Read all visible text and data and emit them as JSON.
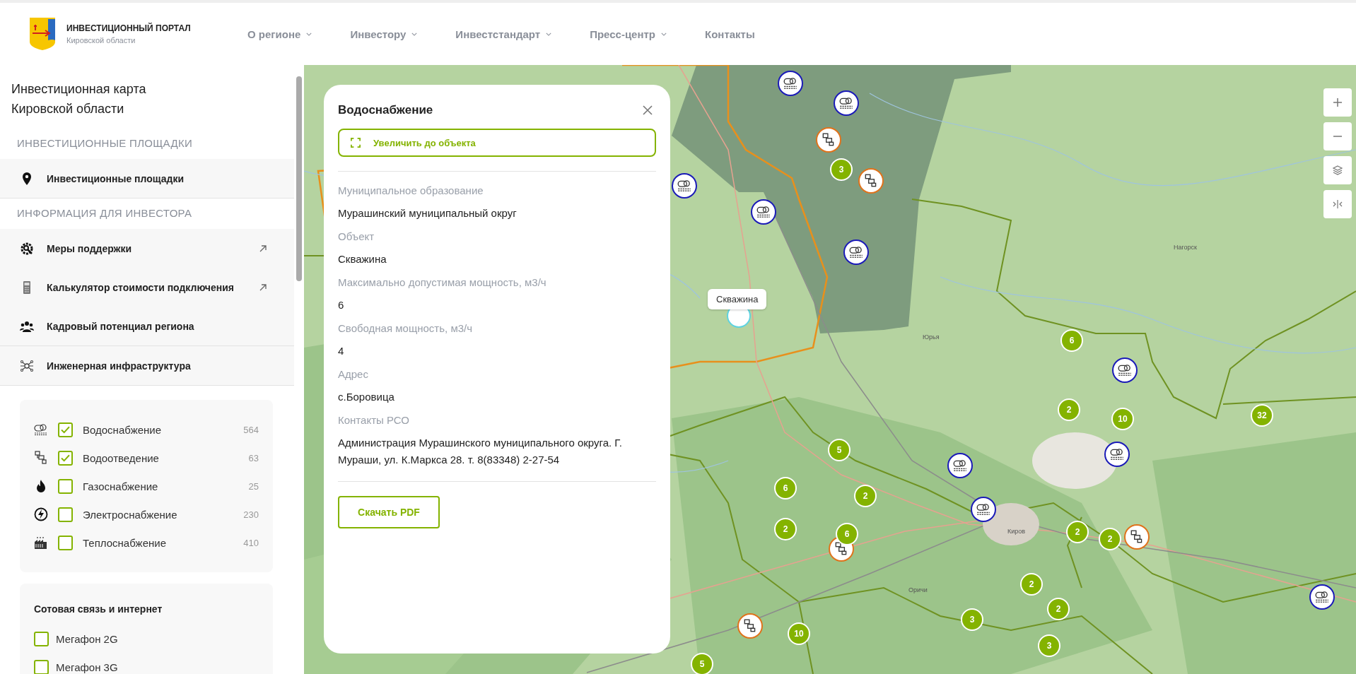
{
  "header": {
    "logo": {
      "title": "ИНВЕСТИЦИОННЫЙ ПОРТАЛ",
      "subtitle": "Кировской области"
    },
    "nav": [
      {
        "label": "О регионе",
        "dropdown": true
      },
      {
        "label": "Инвестору",
        "dropdown": true
      },
      {
        "label": "Инвестстандарт",
        "dropdown": true
      },
      {
        "label": "Пресс-центр",
        "dropdown": true
      },
      {
        "label": "Контакты",
        "dropdown": false
      }
    ]
  },
  "sidebar": {
    "title_lines": [
      "Инвестиционная карта",
      "Кировской области"
    ],
    "sections": [
      {
        "heading": "ИНВЕСТИЦИОННЫЕ ПЛОЩАДКИ",
        "items": [
          {
            "label": "Инвестиционные площадки",
            "kind": "pin",
            "external": false,
            "divider": true
          }
        ]
      },
      {
        "heading": "ИНФОРМАЦИЯ ДЛЯ ИНВЕСТОРА",
        "items": [
          {
            "label": "Меры поддержки",
            "kind": "gear",
            "external": true,
            "divider": false
          },
          {
            "label": "Калькулятор стоимости подключения",
            "kind": "calculator",
            "external": true,
            "divider": false
          },
          {
            "label": "Кадровый потенциал региона",
            "kind": "people",
            "external": false,
            "divider": true
          },
          {
            "label": "Инженерная инфраструктура",
            "kind": "network",
            "external": false,
            "divider": true
          }
        ]
      }
    ],
    "layers": [
      {
        "label": "Водоснабжение",
        "count": "564",
        "checked": true,
        "kind": "water"
      },
      {
        "label": "Водоотведение",
        "count": "63",
        "checked": true,
        "kind": "sewer"
      },
      {
        "label": "Газоснабжение",
        "count": "25",
        "checked": false,
        "kind": "gas"
      },
      {
        "label": "Электроснабжение",
        "count": "230",
        "checked": false,
        "kind": "power"
      },
      {
        "label": "Теплоснабжение",
        "count": "410",
        "checked": false,
        "kind": "heat"
      }
    ],
    "cellular": {
      "title": "Сотовая связь и интернет",
      "options": [
        {
          "label": "Мегафон 2G",
          "checked": false
        },
        {
          "label": "Мегафон 3G",
          "checked": false
        }
      ]
    }
  },
  "popup": {
    "title": "Водоснабжение",
    "zoom_button": "Увеличить до объекта",
    "fields": [
      {
        "label": "Муниципальное образование",
        "value": "Мурашинский муниципальный округ"
      },
      {
        "label": "Объект",
        "value": "Скважина"
      },
      {
        "label": "Максимально допустимая мощность, м3/ч",
        "value": "6"
      },
      {
        "label": "Свободная мощность, м3/ч",
        "value": "4"
      },
      {
        "label": "Адрес",
        "value": "с.Боровица"
      },
      {
        "label": "Контакты РСО",
        "value": "Администрация Мурашинского муниципального округа. Г. Мураши, ул. К.Маркса 28. т. 8(83348) 2-27-54"
      }
    ],
    "download_button": "Скачать PDF"
  },
  "map": {
    "tooltip": "Скважина",
    "place_labels": [
      "Нагорск",
      "Юрья",
      "Киров",
      "Оричи"
    ],
    "markers": [
      {
        "kind": "water"
      },
      {
        "kind": "water"
      },
      {
        "kind": "water"
      },
      {
        "kind": "water"
      },
      {
        "kind": "water"
      },
      {
        "kind": "water"
      },
      {
        "kind": "water"
      },
      {
        "kind": "water"
      },
      {
        "kind": "water"
      },
      {
        "kind": "water"
      },
      {
        "kind": "sewer"
      },
      {
        "kind": "sewer"
      },
      {
        "kind": "sewer"
      },
      {
        "kind": "sewer"
      },
      {
        "kind": "sewer"
      }
    ],
    "clusters": [
      "3",
      "6",
      "2",
      "10",
      "32",
      "5",
      "6",
      "2",
      "2",
      "6",
      "2",
      "2",
      "2",
      "2",
      "3",
      "3",
      "10",
      "5"
    ]
  }
}
